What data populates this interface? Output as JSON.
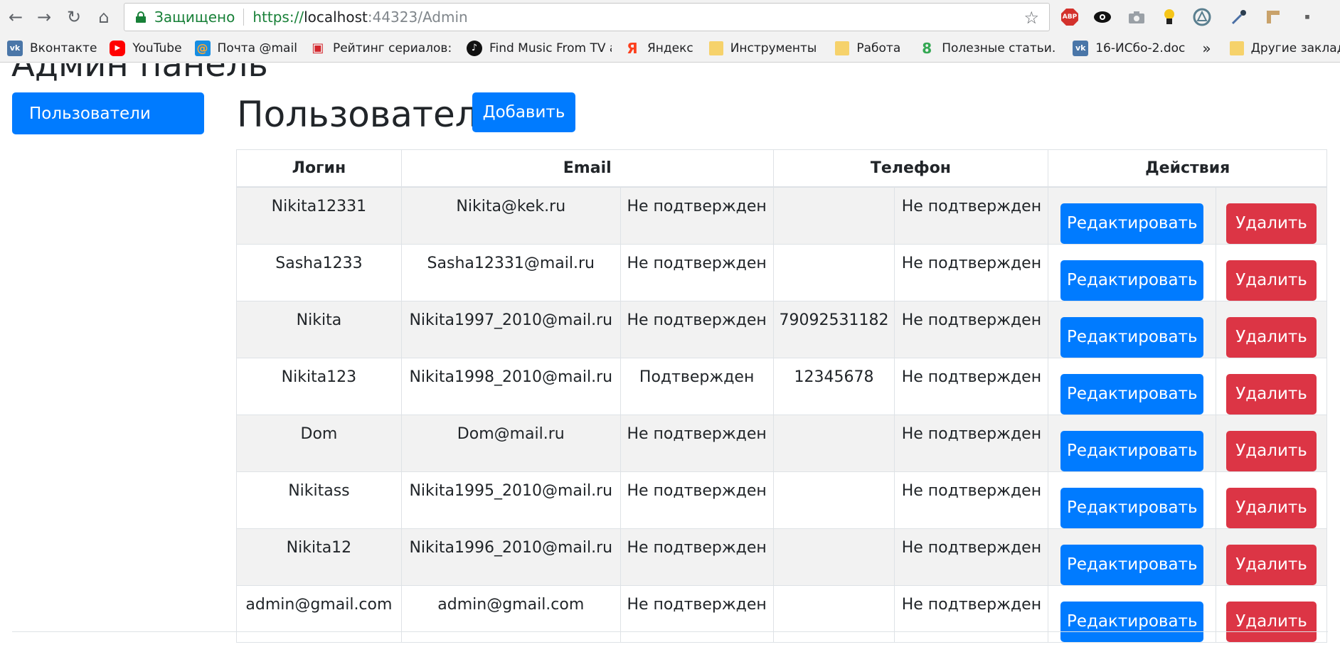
{
  "browser": {
    "secure_label": "Защищено",
    "url_scheme": "https://",
    "url_host": "localhost",
    "url_port_path": ":44323/Admin",
    "abp_label": "ABP"
  },
  "bookmarks": [
    {
      "label": "Вконтакте",
      "icon": "vk-icon",
      "color": "#4a76a8",
      "glyph": "vk"
    },
    {
      "label": "YouTube",
      "icon": "youtube-icon",
      "color": "#ff0000",
      "glyph": "▶"
    },
    {
      "label": "Почта @mail",
      "icon": "mail-icon",
      "color": "#168de2",
      "glyph": "@"
    },
    {
      "label": "Рейтинг сериалов: с",
      "icon": "tv-icon",
      "color": "#d4262c",
      "glyph": "▣"
    },
    {
      "label": "Find Music From TV a",
      "icon": "music-icon",
      "color": "#111111",
      "glyph": "♪"
    },
    {
      "label": "Яндекс",
      "icon": "yandex-icon",
      "color": "#ffffff",
      "glyph": "Я"
    },
    {
      "label": "Инструменты",
      "icon": "folder-icon",
      "color": "#f6d26b",
      "glyph": ""
    },
    {
      "label": "Работа",
      "icon": "folder-icon",
      "color": "#f6d26b",
      "glyph": ""
    },
    {
      "label": "Полезные статьи. Вс",
      "icon": "articles-icon",
      "color": "#ffffff",
      "glyph": "8"
    },
    {
      "label": "16-ИСбо-2.doc",
      "icon": "vk-icon",
      "color": "#4a76a8",
      "glyph": "vk"
    }
  ],
  "bookmarks_more": "»",
  "other_bookmarks": "Другие закладки",
  "page": {
    "title": "Админ панель",
    "sidebar_users": "Пользователи",
    "section_title": "Пользователи",
    "add_label": "Добавить"
  },
  "table": {
    "headers": {
      "login": "Логин",
      "email": "Email",
      "phone": "Телефон",
      "actions": "Действия"
    },
    "edit_label": "Редактировать",
    "delete_label": "Удалить",
    "rows": [
      {
        "login": "Nikita12331",
        "email": "Nikita@kek.ru",
        "email_status": "Не подтвержден",
        "phone": "",
        "phone_status": "Не подтвержден"
      },
      {
        "login": "Sasha1233",
        "email": "Sasha12331@mail.ru",
        "email_status": "Не подтвержден",
        "phone": "",
        "phone_status": "Не подтвержден"
      },
      {
        "login": "Nikita",
        "email": "Nikita1997_2010@mail.ru",
        "email_status": "Не подтвержден",
        "phone": "79092531182",
        "phone_status": "Не подтвержден"
      },
      {
        "login": "Nikita123",
        "email": "Nikita1998_2010@mail.ru",
        "email_status": "Подтвержден",
        "phone": "12345678",
        "phone_status": "Не подтвержден"
      },
      {
        "login": "Dom",
        "email": "Dom@mail.ru",
        "email_status": "Не подтвержден",
        "phone": "",
        "phone_status": "Не подтвержден"
      },
      {
        "login": "Nikitass",
        "email": "Nikita1995_2010@mail.ru",
        "email_status": "Не подтвержден",
        "phone": "",
        "phone_status": "Не подтвержден"
      },
      {
        "login": "Nikita12",
        "email": "Nikita1996_2010@mail.ru",
        "email_status": "Не подтвержден",
        "phone": "",
        "phone_status": "Не подтвержден"
      },
      {
        "login": "admin@gmail.com",
        "email": "admin@gmail.com",
        "email_status": "Не подтвержден",
        "phone": "",
        "phone_status": "Не подтвержден"
      }
    ]
  }
}
